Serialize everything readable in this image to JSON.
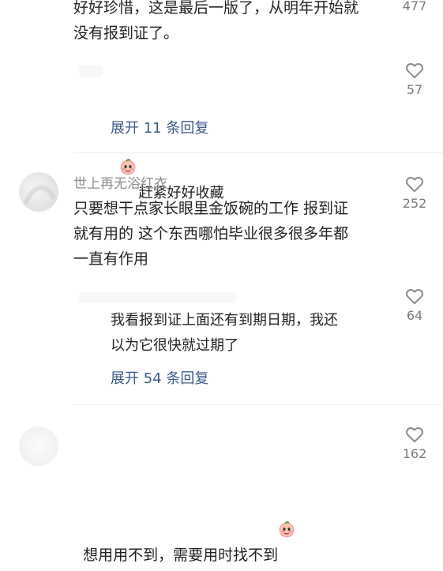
{
  "comments": [
    {
      "id": "c1",
      "text": "好好珍惜，这是最后一版了，从明年开始就\n没有报到证了。",
      "likes": "477",
      "reply": {
        "text": "赶紧好好收藏",
        "emoji": "peach-face-emoji",
        "likes": "57"
      },
      "expand_label": "展开 11 条回复"
    },
    {
      "id": "c2",
      "username": "世上再无浴红衣",
      "text": "只要想干点家长眼里金饭碗的工作 报到证\n就有用的 这个东西哪怕毕业很多很多年都\n一直有作用",
      "likes": "252",
      "reply": {
        "text": "我看报到证上面还有到期日期，我还\n以为它很快就过期了",
        "likes": "64"
      },
      "expand_label": "展开 54 条回复"
    },
    {
      "id": "c3",
      "text": "想用用不到，需要用时找不到",
      "emoji": "peach-face-emoji",
      "likes": "162"
    }
  ],
  "icons": {
    "like": "heart-outline-icon",
    "emoji": "peach-face-emoji"
  },
  "colors": {
    "link": "#3b5a86",
    "muted": "#8d8d8d",
    "text": "#222222"
  }
}
